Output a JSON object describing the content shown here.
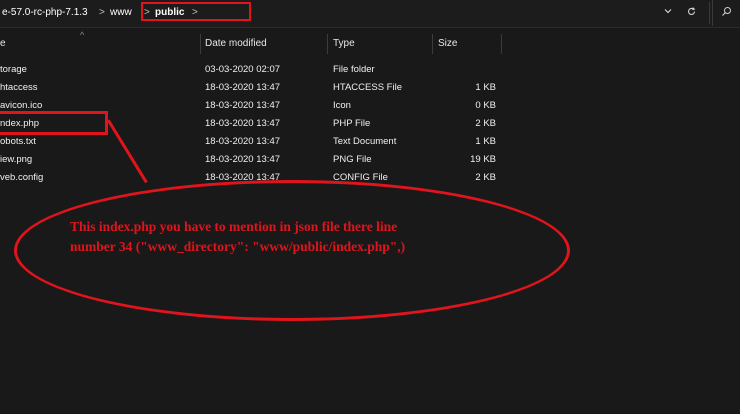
{
  "breadcrumb": {
    "segments": [
      "e-57.0-rc-php-7.1.3",
      "www",
      "public"
    ],
    "separator": ">"
  },
  "toolbar": {
    "dropdown_icon": "chevron-down-icon",
    "refresh_icon": "refresh-icon"
  },
  "columns": {
    "name": "e",
    "date_modified": "Date modified",
    "type": "Type",
    "size": "Size"
  },
  "files": [
    {
      "name": "torage",
      "date": "03-03-2020 02:07",
      "type": "File folder",
      "size": ""
    },
    {
      "name": "htaccess",
      "date": "18-03-2020 13:47",
      "type": "HTACCESS File",
      "size": "1 KB"
    },
    {
      "name": "avicon.ico",
      "date": "18-03-2020 13:47",
      "type": "Icon",
      "size": "0 KB"
    },
    {
      "name": "ndex.php",
      "date": "18-03-2020 13:47",
      "type": "PHP File",
      "size": "2 KB"
    },
    {
      "name": "obots.txt",
      "date": "18-03-2020 13:47",
      "type": "Text Document",
      "size": "1 KB"
    },
    {
      "name": "iew.png",
      "date": "18-03-2020 13:47",
      "type": "PNG File",
      "size": "19 KB"
    },
    {
      "name": "veb.config",
      "date": "18-03-2020 13:47",
      "type": "CONFIG File",
      "size": "2 KB"
    }
  ],
  "annotation": {
    "line1": "This index.php you have to mention in json file there line",
    "line2": "number 34 (\"www_directory\": \"www/public/index.php\",)",
    "color": "#e0141c"
  }
}
